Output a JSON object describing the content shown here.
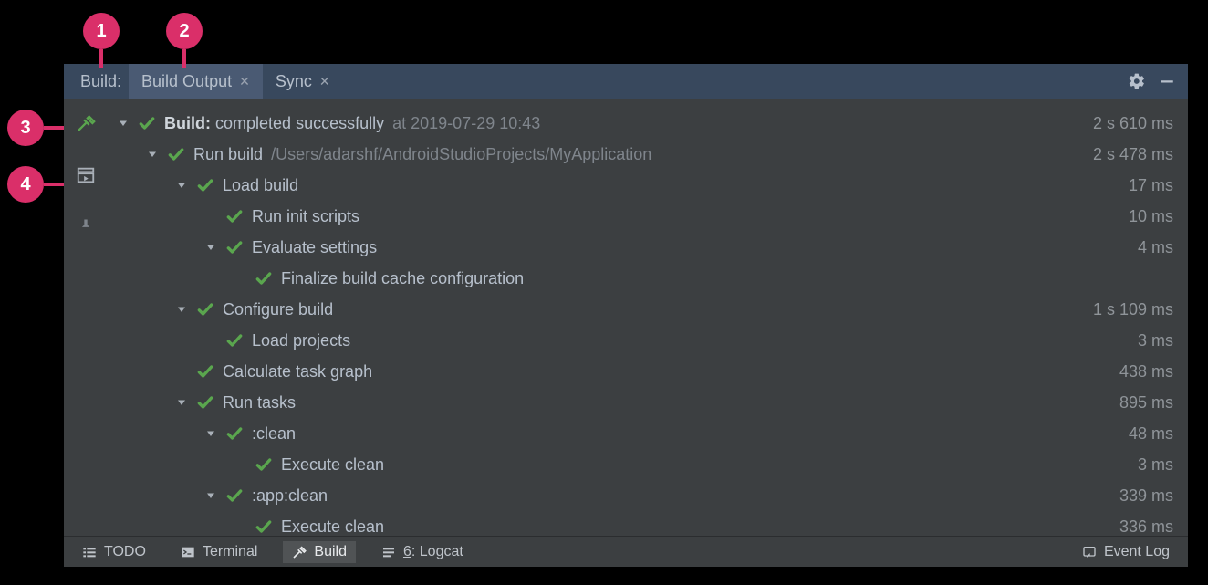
{
  "callouts": [
    "1",
    "2",
    "3",
    "4"
  ],
  "header": {
    "title": "Build:",
    "tabs": [
      {
        "label": "Build Output",
        "active": true
      },
      {
        "label": "Sync",
        "active": false
      }
    ]
  },
  "gutter": {
    "hammer": "hammer-icon",
    "restart": "restart-icon",
    "pin": "pin-icon"
  },
  "tree": [
    {
      "depth": 0,
      "caret": true,
      "bold": "Build:",
      "text": "completed successfully",
      "dim": "at 2019-07-29 10:43",
      "duration": "2 s 610 ms"
    },
    {
      "depth": 1,
      "caret": true,
      "text": "Run build",
      "dim": "/Users/adarshf/AndroidStudioProjects/MyApplication",
      "duration": "2 s 478 ms"
    },
    {
      "depth": 2,
      "caret": true,
      "text": "Load build",
      "duration": "17 ms"
    },
    {
      "depth": 3,
      "caret": false,
      "text": "Run init scripts",
      "duration": "10 ms"
    },
    {
      "depth": 3,
      "caret": true,
      "text": "Evaluate settings",
      "duration": "4 ms"
    },
    {
      "depth": 4,
      "caret": false,
      "text": "Finalize build cache configuration",
      "duration": ""
    },
    {
      "depth": 2,
      "caret": true,
      "text": "Configure build",
      "duration": "1 s 109 ms"
    },
    {
      "depth": 3,
      "caret": false,
      "text": "Load projects",
      "duration": "3 ms"
    },
    {
      "depth": 2,
      "caret": false,
      "text": "Calculate task graph",
      "duration": "438 ms"
    },
    {
      "depth": 2,
      "caret": true,
      "text": "Run tasks",
      "duration": "895 ms"
    },
    {
      "depth": 3,
      "caret": true,
      "text": ":clean",
      "duration": "48 ms"
    },
    {
      "depth": 4,
      "caret": false,
      "text": "Execute clean",
      "duration": "3 ms"
    },
    {
      "depth": 3,
      "caret": true,
      "text": ":app:clean",
      "duration": "339 ms"
    },
    {
      "depth": 4,
      "caret": false,
      "text": "Execute clean",
      "duration": "336 ms"
    }
  ],
  "footer": {
    "todo": "TODO",
    "terminal": "Terminal",
    "build": "Build",
    "logcat_prefix": "6",
    "logcat": ": Logcat",
    "eventlog": "Event Log"
  }
}
